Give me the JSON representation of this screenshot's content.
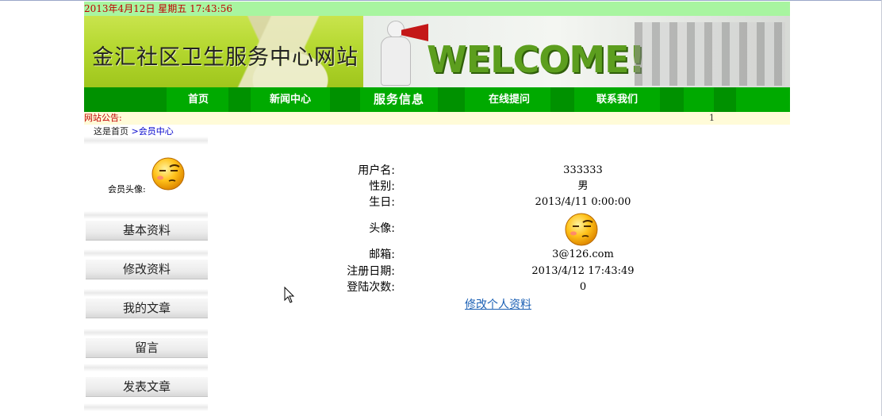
{
  "header": {
    "datetime": "2013年4月12日  星期五  17:43:56",
    "site_title": "金汇社区卫生服务中心网站",
    "welcome": "WELCOME!"
  },
  "nav": {
    "items": [
      {
        "label": "首页"
      },
      {
        "label": "新闻中心"
      },
      {
        "label": "服务信息"
      },
      {
        "label": "在线提问"
      },
      {
        "label": "联系我们"
      }
    ]
  },
  "notice": {
    "label": "网站公告:",
    "marquee": "1"
  },
  "breadcrumb": {
    "home": "这是首页",
    "current": ">会员中心"
  },
  "sidebar": {
    "avatar_label": "会员头像:",
    "items": [
      {
        "label": "基本资料"
      },
      {
        "label": "修改资料"
      },
      {
        "label": "我的文章"
      },
      {
        "label": "留言"
      },
      {
        "label": "发表文章"
      }
    ]
  },
  "profile": {
    "rows": [
      {
        "label": "用户名:",
        "value": "333333"
      },
      {
        "label": "性别:",
        "value": "男"
      },
      {
        "label": "生日:",
        "value": "2013/4/11 0:00:00"
      },
      {
        "label": "头像:",
        "value": ""
      },
      {
        "label": "邮箱:",
        "value": "3@126.com"
      },
      {
        "label": "注册日期:",
        "value": "2013/4/12 17:43:49"
      },
      {
        "label": "登陆次数:",
        "value": "0"
      }
    ],
    "edit_link": "修改个人资料"
  },
  "colors": {
    "nav_green": "#00aa00",
    "date_bar": "#a8f5a0",
    "alert_red": "#c00000",
    "link_blue": "#1a5fb4"
  }
}
